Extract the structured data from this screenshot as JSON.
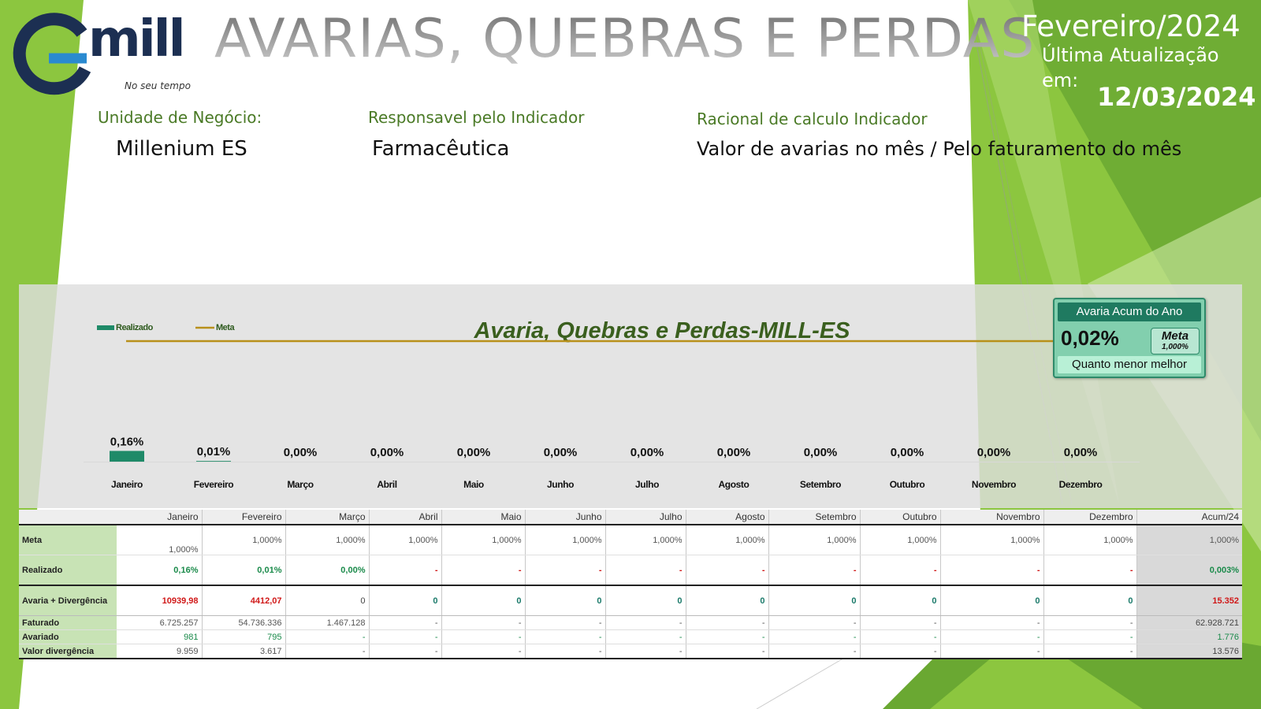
{
  "header": {
    "title": "AVARIAS, QUEBRAS E PERDAS",
    "period": "Fevereiro/2024",
    "update_label_1": "Última Atualização",
    "update_label_2": "em:",
    "update_date": "12/03/2024"
  },
  "logo": {
    "word": "mill",
    "tagline": "No seu tempo"
  },
  "info": {
    "unit_label": "Unidade de Negócio:",
    "unit_value": "Millenium ES",
    "owner_label": "Responsavel pelo Indicador",
    "owner_value": "Farmacêutica",
    "calc_label": "Racional de calculo Indicador",
    "calc_value": "Valor de avarias no mês / Pelo faturamento do mês"
  },
  "kpi": {
    "title": "Avaria Acum do Ano",
    "value": "0,02%",
    "meta_label": "Meta",
    "meta_value": "1,000%",
    "footer": "Quanto menor melhor"
  },
  "colors": {
    "bar": "#1f8a68",
    "meta_line": "#b8901a",
    "title": "#3a5f1e",
    "green_bg": "#8cc63f"
  },
  "chart_data": {
    "type": "bar",
    "title": "Avaria, Quebras e Perdas-MILL-ES",
    "legend_position": "top-left",
    "categories": [
      "Janeiro",
      "Fevereiro",
      "Março",
      "Abril",
      "Maio",
      "Junho",
      "Julho",
      "Agosto",
      "Setembro",
      "Outubro",
      "Novembro",
      "Dezembro"
    ],
    "series": [
      {
        "name": "Realizado",
        "type": "bar",
        "values": [
          0.16,
          0.01,
          0,
          0,
          0,
          0,
          0,
          0,
          0,
          0,
          0,
          0
        ],
        "labels": [
          "0,16%",
          "0,01%",
          "0,00%",
          "0,00%",
          "0,00%",
          "0,00%",
          "0,00%",
          "0,00%",
          "0,00%",
          "0,00%",
          "0,00%",
          "0,00%"
        ]
      },
      {
        "name": "Meta",
        "type": "line",
        "values": [
          1,
          1,
          1,
          1,
          1,
          1,
          1,
          1,
          1,
          1,
          1,
          1
        ],
        "end_label": "1,000%"
      }
    ],
    "ylim": [
      0,
      1.6
    ]
  },
  "table": {
    "columns": [
      "",
      "Janeiro",
      "Fevereiro",
      "Março",
      "Abril",
      "Maio",
      "Junho",
      "Julho",
      "Agosto",
      "Setembro",
      "Outubro",
      "Novembro",
      "Dezembro",
      "Acum/24"
    ],
    "rows": [
      {
        "label": "Meta",
        "cells": [
          "1,000%",
          "1,000%",
          "1,000%",
          "1,000%",
          "1,000%",
          "1,000%",
          "1,000%",
          "1,000%",
          "1,000%",
          "1,000%",
          "1,000%",
          "1,000%",
          "1,000%"
        ]
      },
      {
        "label": "Realizado",
        "cells": [
          "0,16%",
          "0,01%",
          "0,00%",
          "-",
          "-",
          "-",
          "-",
          "-",
          "-",
          "-",
          "-",
          "-",
          "0,003%"
        ]
      },
      {
        "label": "Avaria + Divergência",
        "cells": [
          "10939,98",
          "4412,07",
          "0",
          "0",
          "0",
          "0",
          "0",
          "0",
          "0",
          "0",
          "0",
          "0",
          "15.352"
        ]
      },
      {
        "label": "Faturado",
        "cells": [
          "6.725.257",
          "54.736.336",
          "1.467.128",
          "-",
          "-",
          "-",
          "-",
          "-",
          "-",
          "-",
          "-",
          "-",
          "62.928.721"
        ]
      },
      {
        "label": "Avariado",
        "cells": [
          "981",
          "795",
          "-",
          "-",
          "-",
          "-",
          "-",
          "-",
          "-",
          "-",
          "-",
          "-",
          "1.776"
        ]
      },
      {
        "label": "Valor divergência",
        "cells": [
          "9.959",
          "3.617",
          "-",
          "-",
          "-",
          "-",
          "-",
          "-",
          "-",
          "-",
          "-",
          "-",
          "13.576"
        ]
      }
    ]
  }
}
